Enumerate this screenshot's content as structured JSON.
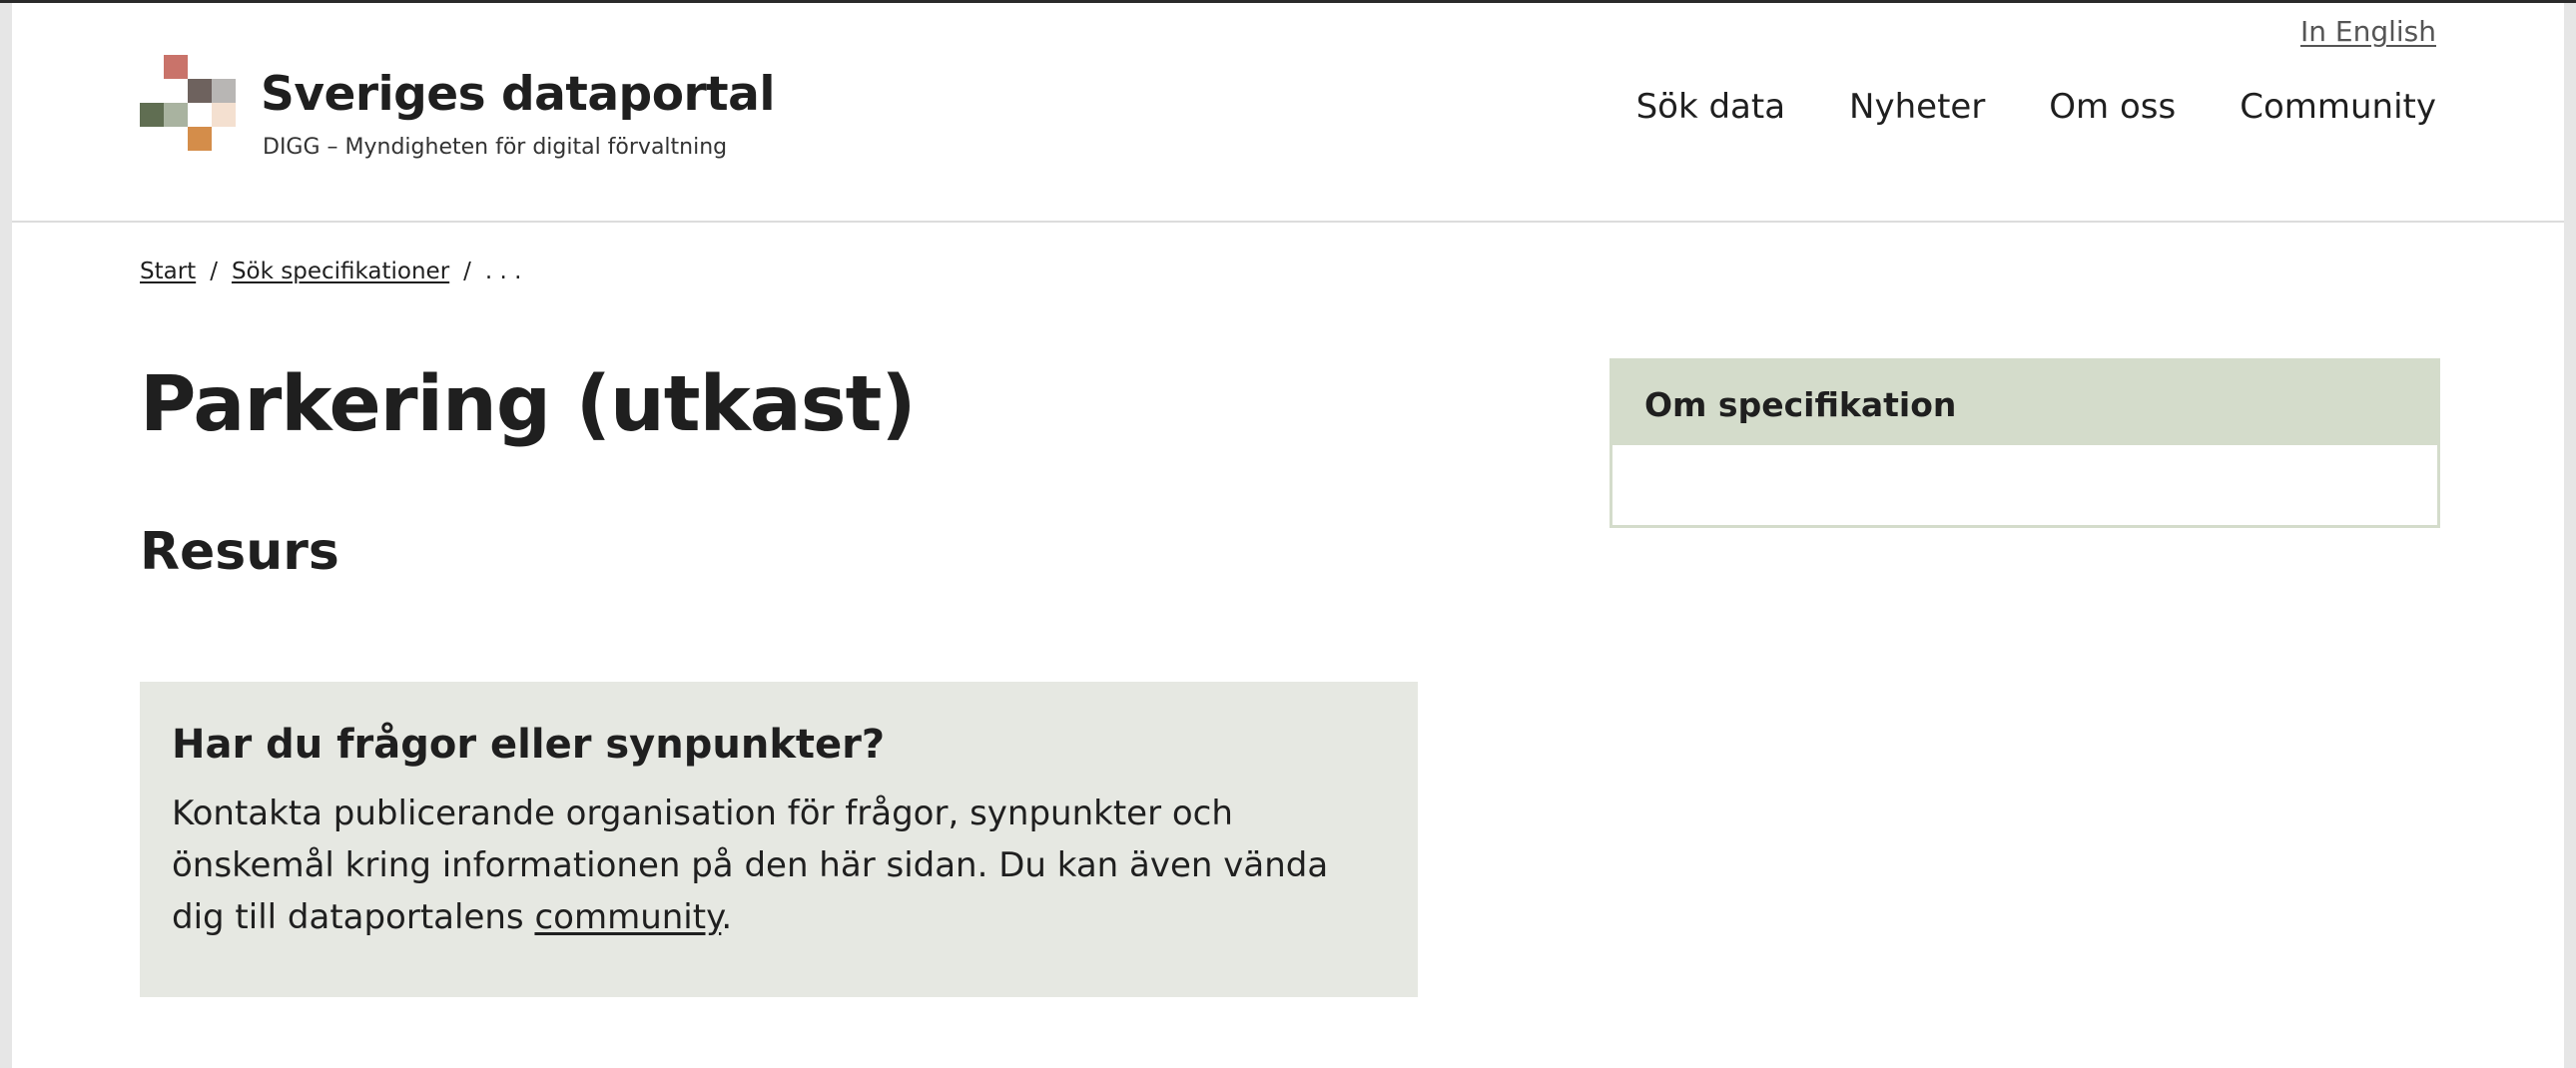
{
  "header": {
    "language_link": "In English",
    "site_title": "Sveriges dataportal",
    "site_subtitle": "DIGG – Myndigheten för digital förvaltning",
    "logo_colors": {
      "rose": "#c9736a",
      "brown": "#6e625e",
      "light_gray": "#b8b6b4",
      "dark_green": "#606e52",
      "sage": "#a9b3a0",
      "peach": "#f4e0d0",
      "orange": "#d48d4a"
    },
    "nav": [
      {
        "label": "Sök data"
      },
      {
        "label": "Nyheter"
      },
      {
        "label": "Om oss"
      },
      {
        "label": "Community"
      }
    ]
  },
  "breadcrumb": {
    "items": [
      "Start",
      "Sök specifikationer"
    ],
    "separator": "/",
    "current": ". . ."
  },
  "main": {
    "title": "Parkering (utkast)",
    "section_heading": "Resurs"
  },
  "sidebar": {
    "card_title": "Om specifikation"
  },
  "contact_box": {
    "title": "Har du frågor eller synpunkter?",
    "text_before_link": "Kontakta publicerande organisation för frågor, synpunkter och önskemål kring informationen på den här sidan. Du kan även vända dig till dataportalens ",
    "link_label": "community",
    "text_after_link": "."
  }
}
